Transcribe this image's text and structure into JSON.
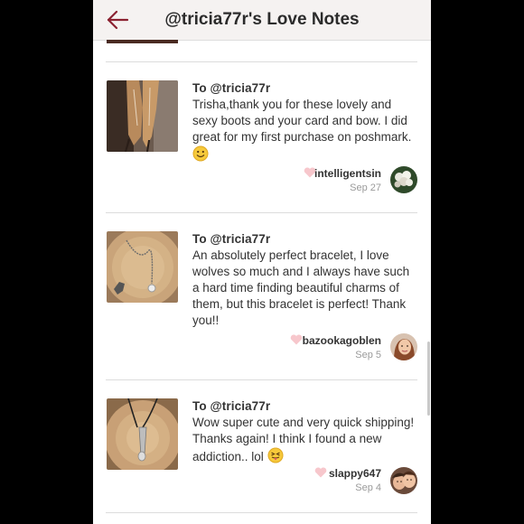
{
  "header": {
    "title": "@tricia77r's Love Notes"
  },
  "notes": [
    {
      "to": "To @tricia77r",
      "message": "Trisha,thank you for these lovely and sexy boots and your card and bow. I did great for my first purchase on poshmark.",
      "emoji": "smile",
      "user": "intelligentsin",
      "date": "Sep 27"
    },
    {
      "to": "To @tricia77r",
      "message": "An absolutely perfect bracelet, I love wolves so much and I always have such a hard time finding beautiful charms of them, but this bracelet is perfect! Thank you!!",
      "user": "bazookagoblen",
      "date": "Sep 5"
    },
    {
      "to": "To @tricia77r",
      "message": "Wow super cute and very quick shipping! Thanks again! I think I found a new addiction.. lol",
      "emoji": "tongue",
      "user": "slappy647",
      "date": "Sep 4"
    }
  ],
  "colors": {
    "accent": "#8b2231",
    "heart": "#f7c7cc",
    "separator": "#dcdcdc"
  }
}
